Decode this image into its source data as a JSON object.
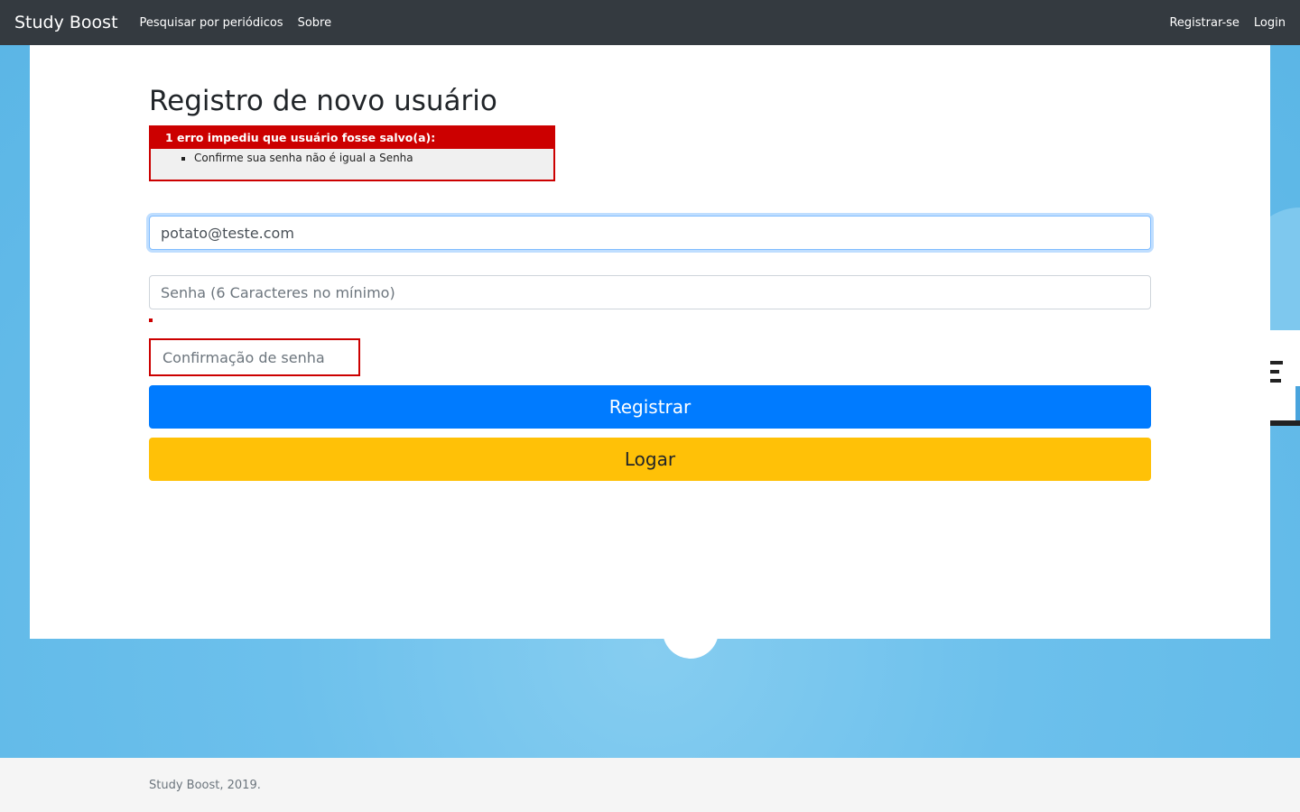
{
  "navbar": {
    "brand": "Study Boost",
    "links": [
      "Pesquisar por periódicos",
      "Sobre"
    ],
    "right_links": [
      "Registrar-se",
      "Login"
    ]
  },
  "page": {
    "title": "Registro de novo usuário"
  },
  "error": {
    "heading": "1 erro impediu que usuário fosse salvo(a):",
    "items": [
      "Confirme sua senha não é igual a Senha"
    ]
  },
  "form": {
    "email_value": "potato@teste.com",
    "password_placeholder": "Senha (6 Caracteres no mínimo)",
    "confirm_placeholder": "Confirmação de senha",
    "register_label": "Registrar",
    "login_label": "Logar"
  },
  "footer": {
    "text": "Study Boost, 2019."
  },
  "colors": {
    "navbar_bg": "#343a40",
    "primary": "#007bff",
    "warning": "#ffc107",
    "error": "#cc0000",
    "background": "#5dbbe8"
  }
}
